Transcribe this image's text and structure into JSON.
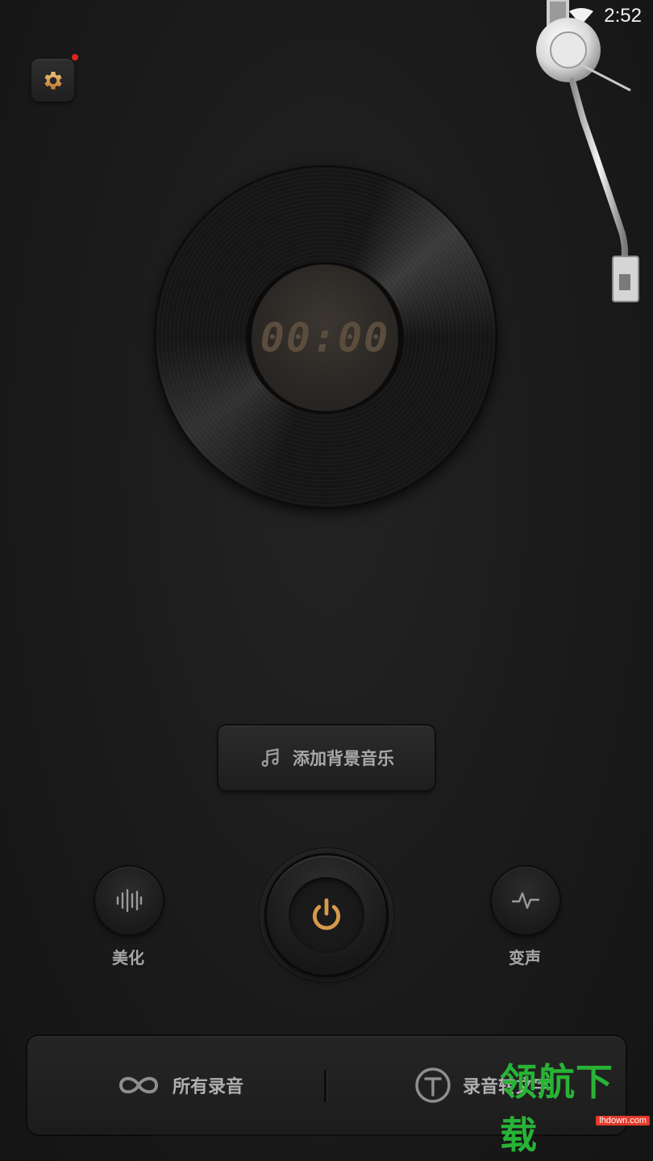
{
  "status_bar": {
    "time": "2:52",
    "wifi_icon": "wifi-icon"
  },
  "settings": {
    "icon": "gear-icon",
    "has_notification": true
  },
  "player": {
    "timer": "00:00"
  },
  "bgm_button": {
    "label": "添加背景音乐",
    "icon": "music-note-icon"
  },
  "controls": {
    "beautify": {
      "label": "美化",
      "icon": "waveform-icon"
    },
    "voice_change": {
      "label": "变声",
      "icon": "pulse-icon"
    },
    "record": {
      "icon": "power-icon"
    }
  },
  "bottom_bar": {
    "all_recordings": {
      "label": "所有录音",
      "icon": "infinity-icon"
    },
    "speech_to_text": {
      "label": "录音转文字",
      "icon": "text-t-icon"
    }
  },
  "watermark": {
    "text": "领航下载",
    "url": "lhdown.com"
  },
  "colors": {
    "accent": "#d89a4e",
    "background": "#1b1b1b",
    "notify": "#e0261f"
  }
}
